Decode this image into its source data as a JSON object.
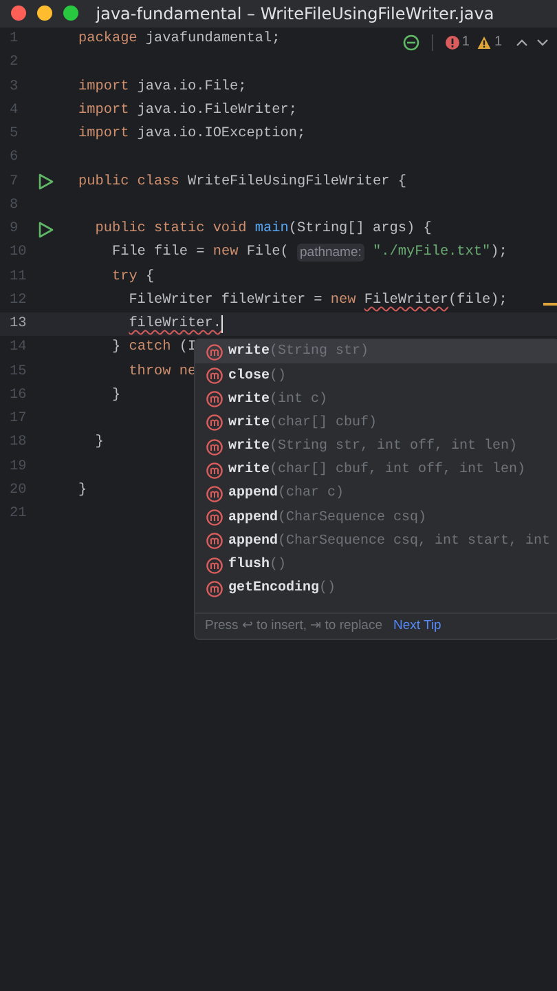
{
  "window": {
    "title": "java-fundamental – WriteFileUsingFileWriter.java"
  },
  "inspections": {
    "errors": "1",
    "warnings": "1"
  },
  "lines": [
    {
      "number": "1",
      "run": false,
      "current": false,
      "tokens": [
        {
          "kind": "keyword",
          "text": "package "
        },
        {
          "kind": "plain",
          "text": "javafundamental;"
        }
      ]
    },
    {
      "number": "2",
      "run": false,
      "current": false
    },
    {
      "number": "3",
      "run": false,
      "current": false,
      "tokens": [
        {
          "kind": "keyword",
          "text": "import "
        },
        {
          "kind": "plain",
          "text": "java.io.File;"
        }
      ]
    },
    {
      "number": "4",
      "run": false,
      "current": false,
      "tokens": [
        {
          "kind": "keyword",
          "text": "import "
        },
        {
          "kind": "plain",
          "text": "java.io.FileWriter;"
        }
      ]
    },
    {
      "number": "5",
      "run": false,
      "current": false,
      "tokens": [
        {
          "kind": "keyword",
          "text": "import "
        },
        {
          "kind": "plain",
          "text": "java.io.IOException;"
        }
      ]
    },
    {
      "number": "6",
      "run": false,
      "current": false
    },
    {
      "number": "7",
      "run": true,
      "current": false,
      "tokens": [
        {
          "kind": "keyword",
          "text": "public class "
        },
        {
          "kind": "plain",
          "text": "WriteFileUsingFileWriter {"
        }
      ]
    },
    {
      "number": "8",
      "run": false,
      "current": false
    },
    {
      "number": "9",
      "run": true,
      "current": false,
      "tokens": [
        {
          "kind": "keyword",
          "text": "  public static void "
        },
        {
          "kind": "function",
          "text": "main"
        },
        {
          "kind": "plain",
          "text": "(String[] args) {"
        }
      ]
    },
    {
      "number": "10",
      "run": false,
      "current": false,
      "tokens": [
        {
          "kind": "plain",
          "text": "    File file = "
        },
        {
          "kind": "keyword",
          "text": "new "
        },
        {
          "kind": "plain",
          "text": "File( "
        },
        {
          "kind": "hint",
          "text": "pathname:"
        },
        {
          "kind": "string",
          "text": " \"./myFile.txt\""
        },
        {
          "kind": "plain",
          "text": ");"
        }
      ]
    },
    {
      "number": "11",
      "run": false,
      "current": false,
      "tokens": [
        {
          "kind": "keyword",
          "text": "    try "
        },
        {
          "kind": "plain",
          "text": "{"
        }
      ]
    },
    {
      "number": "12",
      "run": false,
      "current": false,
      "tokens": [
        {
          "kind": "plain",
          "text": "      FileWriter fileWriter = "
        },
        {
          "kind": "keyword",
          "text": "new "
        },
        {
          "kind": "error",
          "text": "FileWriter"
        },
        {
          "kind": "plain",
          "text": "(file);"
        }
      ]
    },
    {
      "number": "13",
      "run": false,
      "current": true,
      "tokens": [
        {
          "kind": "error",
          "text": "      fileWriter."
        }
      ]
    },
    {
      "number": "14",
      "run": false,
      "current": false,
      "tokens": [
        {
          "kind": "plain",
          "text": "    } "
        },
        {
          "kind": "keyword",
          "text": "catch "
        },
        {
          "kind": "plain",
          "text": "(I"
        }
      ]
    },
    {
      "number": "15",
      "run": false,
      "current": false,
      "tokens": [
        {
          "kind": "keyword",
          "text": "      throw ne"
        }
      ]
    },
    {
      "number": "16",
      "run": false,
      "current": false,
      "tokens": [
        {
          "kind": "plain",
          "text": "    }"
        }
      ]
    },
    {
      "number": "17",
      "run": false,
      "current": false
    },
    {
      "number": "18",
      "run": false,
      "current": false,
      "tokens": [
        {
          "kind": "plain",
          "text": "  }"
        }
      ]
    },
    {
      "number": "19",
      "run": false,
      "current": false
    },
    {
      "number": "20",
      "run": false,
      "current": false,
      "tokens": [
        {
          "kind": "plain",
          "text": "}"
        }
      ]
    },
    {
      "number": "21",
      "run": false,
      "current": false
    }
  ],
  "completion": {
    "items": [
      {
        "name": "write",
        "params": "(String str)",
        "selected": true
      },
      {
        "name": "close",
        "params": "()",
        "selected": false
      },
      {
        "name": "write",
        "params": "(int c)",
        "selected": false
      },
      {
        "name": "write",
        "params": "(char[] cbuf)",
        "selected": false
      },
      {
        "name": "write",
        "params": "(String str, int off, int len)",
        "selected": false
      },
      {
        "name": "write",
        "params": "(char[] cbuf, int off, int len)",
        "selected": false
      },
      {
        "name": "append",
        "params": "(char c)",
        "selected": false
      },
      {
        "name": "append",
        "params": "(CharSequence csq)",
        "selected": false
      },
      {
        "name": "append",
        "params": "(CharSequence csq, int start, int",
        "selected": false
      },
      {
        "name": "flush",
        "params": "()",
        "selected": false
      },
      {
        "name": "getEncoding",
        "params": "()",
        "selected": false
      }
    ],
    "footer": "Press ↩ to insert, ⇥ to replace",
    "tip_link": "Next Tip"
  }
}
